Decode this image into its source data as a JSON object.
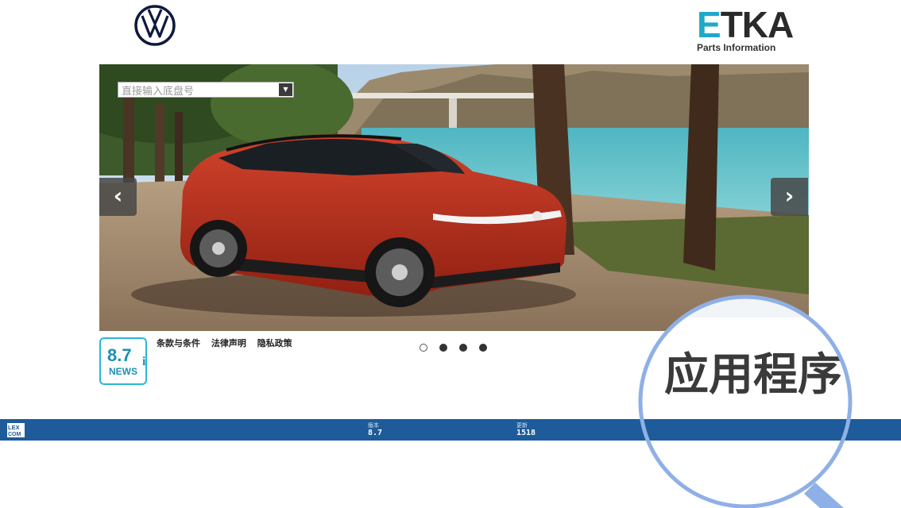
{
  "header": {
    "left_logo_icon": "vw-logo-icon",
    "right_logo_title": "ETKA",
    "right_logo_subtitle": "Parts Information"
  },
  "search": {
    "placeholder": "直接输入底盘号",
    "dropdown_icon": "triangle-down-icon"
  },
  "carousel": {
    "prev_icon": "chevron-left-icon",
    "next_icon": "chevron-right-icon",
    "slide_count": 4,
    "active_index": 0
  },
  "news": {
    "version": "8.7",
    "label": "NEWS",
    "info_glyph": "i"
  },
  "footer_links": [
    "条款与条件",
    "法律声明",
    "隐私政策"
  ],
  "status_bar": {
    "brand_top": "LEX",
    "brand_bottom": "COM",
    "version_label": "版本",
    "version_value": "8.7",
    "update_label": "更新",
    "update_value": "1518"
  },
  "magnifier": {
    "text": "应用程序"
  },
  "colors": {
    "status_bar": "#1d5b9a",
    "accent": "#1fa9c9",
    "magnifier_ring": "#8fb0e6"
  }
}
